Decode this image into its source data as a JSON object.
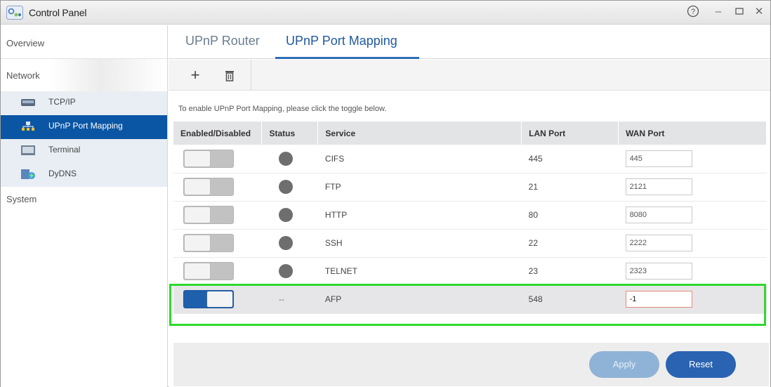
{
  "window": {
    "title": "Control Panel",
    "controls": {
      "help": "?",
      "minimize": "–",
      "maximize": "□",
      "close": "✕"
    }
  },
  "sidebar": {
    "overview": "Overview",
    "network": "Network",
    "items": [
      {
        "label": "TCP/IP",
        "icon": "network-card-icon"
      },
      {
        "label": "UPnP Port Mapping",
        "icon": "upnp-icon",
        "active": true
      },
      {
        "label": "Terminal",
        "icon": "terminal-icon"
      },
      {
        "label": "DyDNS",
        "icon": "dydns-icon"
      }
    ],
    "system": "System"
  },
  "tabs": [
    {
      "label": "UPnP Router"
    },
    {
      "label": "UPnP Port Mapping",
      "active": true
    }
  ],
  "toolbar": {
    "add": "+",
    "delete_icon": "trash-icon"
  },
  "hint": "To enable UPnP Port Mapping, please click the toggle below.",
  "table": {
    "headers": [
      "Enabled/Disabled",
      "Status",
      "Service",
      "LAN Port",
      "WAN Port"
    ],
    "rows": [
      {
        "enabled": false,
        "status": "dot",
        "service": "CIFS",
        "lan": "445",
        "wan": "445"
      },
      {
        "enabled": false,
        "status": "dot",
        "service": "FTP",
        "lan": "21",
        "wan": "2121"
      },
      {
        "enabled": false,
        "status": "dot",
        "service": "HTTP",
        "lan": "80",
        "wan": "8080"
      },
      {
        "enabled": false,
        "status": "dot",
        "service": "SSH",
        "lan": "22",
        "wan": "2222"
      },
      {
        "enabled": false,
        "status": "dot",
        "service": "TELNET",
        "lan": "23",
        "wan": "2323"
      },
      {
        "enabled": true,
        "status": "--",
        "service": "AFP",
        "lan": "548",
        "wan": "-1"
      }
    ]
  },
  "buttons": {
    "apply": "Apply",
    "reset": "Reset"
  },
  "colors": {
    "accent": "#1f60ad",
    "highlight": "#2fd92f",
    "error_border": "#e28b7a"
  }
}
